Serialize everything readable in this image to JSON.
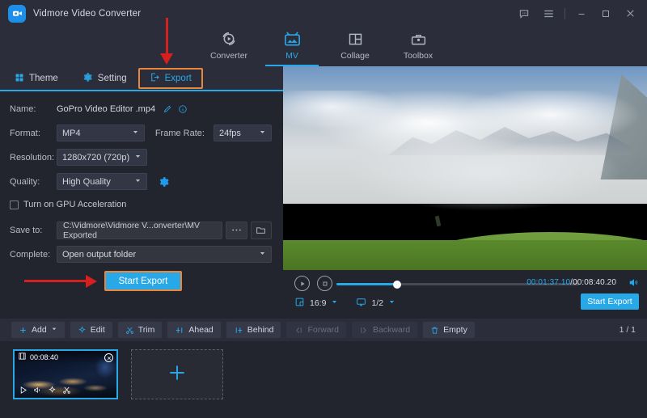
{
  "window": {
    "title": "Vidmore Video Converter",
    "logo_icon": "video-camera-icon",
    "controls": {
      "feedback_icon": "chat-bubble-icon",
      "menu_icon": "hamburger-menu-icon",
      "minimize_icon": "minimize-icon",
      "maximize_icon": "maximize-icon",
      "close_icon": "close-icon"
    }
  },
  "main_tabs": [
    {
      "label": "Converter",
      "icon": "converter-icon",
      "active": false
    },
    {
      "label": "MV",
      "icon": "mv-icon",
      "active": true
    },
    {
      "label": "Collage",
      "icon": "collage-icon",
      "active": false
    },
    {
      "label": "Toolbox",
      "icon": "toolbox-icon",
      "active": false
    }
  ],
  "sub_tabs": [
    {
      "label": "Theme",
      "icon": "theme-grid-icon",
      "selected": false,
      "highlighted": false
    },
    {
      "label": "Setting",
      "icon": "gear-icon",
      "selected": false,
      "highlighted": false
    },
    {
      "label": "Export",
      "icon": "export-icon",
      "selected": true,
      "highlighted": true
    }
  ],
  "export_form": {
    "name_label": "Name:",
    "name_value": "GoPro Video Editor .mp4",
    "edit_icon": "pencil-icon",
    "info_icon": "info-icon",
    "format_label": "Format:",
    "format_value": "MP4",
    "frame_rate_label": "Frame Rate:",
    "frame_rate_value": "24fps",
    "resolution_label": "Resolution:",
    "resolution_value": "1280x720 (720p)",
    "quality_label": "Quality:",
    "quality_value": "High Quality",
    "quality_settings_icon": "gear-icon",
    "gpu_label": "Turn on GPU Acceleration",
    "gpu_checked": false,
    "save_to_label": "Save to:",
    "save_to_value": "C:\\Vidmore\\Vidmore V...onverter\\MV Exported",
    "browse_icon": "ellipsis-icon",
    "folder_icon": "folder-icon",
    "complete_label": "Complete:",
    "complete_value": "Open output folder",
    "start_export_label": "Start Export"
  },
  "player": {
    "play_icon": "play-icon",
    "stop_icon": "stop-icon",
    "current_time": "00:01:37.10",
    "separator": "/",
    "total_time": "00:08:40.20",
    "volume_icon": "volume-icon",
    "aspect_icon": "aspect-ratio-icon",
    "aspect_value": "16:9",
    "aspect_caret": "chevron-down-icon",
    "screen_icon": "monitor-icon",
    "zoom_value": "1/2",
    "zoom_caret": "chevron-down-icon",
    "start_export_label": "Start Export",
    "progress_percent": 25
  },
  "toolbar": {
    "buttons": [
      {
        "label": "Add",
        "icon": "plus-icon",
        "disabled": false,
        "has_caret": true
      },
      {
        "label": "Edit",
        "icon": "magic-wand-icon",
        "disabled": false,
        "has_caret": false
      },
      {
        "label": "Trim",
        "icon": "scissors-icon",
        "disabled": false,
        "has_caret": false
      },
      {
        "label": "Ahead",
        "icon": "insert-ahead-icon",
        "disabled": false,
        "has_caret": false
      },
      {
        "label": "Behind",
        "icon": "insert-behind-icon",
        "disabled": false,
        "has_caret": false
      },
      {
        "label": "Forward",
        "icon": "move-forward-icon",
        "disabled": true,
        "has_caret": false
      },
      {
        "label": "Backward",
        "icon": "move-backward-icon",
        "disabled": true,
        "has_caret": false
      },
      {
        "label": "Empty",
        "icon": "trash-icon",
        "disabled": false,
        "has_caret": false
      }
    ],
    "page_indicator": "1 / 1"
  },
  "filmstrip": {
    "clip": {
      "duration": "00:08:40",
      "film_icon": "film-strip-icon",
      "close_icon": "close-icon",
      "play_icon": "play-icon",
      "volume_icon": "volume-icon",
      "effect_icon": "magic-wand-icon",
      "cut_icon": "scissors-icon"
    },
    "add_tile_icon": "plus-icon"
  },
  "annotations": {
    "arrow_color": "#d61f1f",
    "highlight_color": "#e8863c"
  },
  "colors": {
    "accent": "#29a8e8",
    "background": "#22242e",
    "panel": "#2b2d3a"
  }
}
